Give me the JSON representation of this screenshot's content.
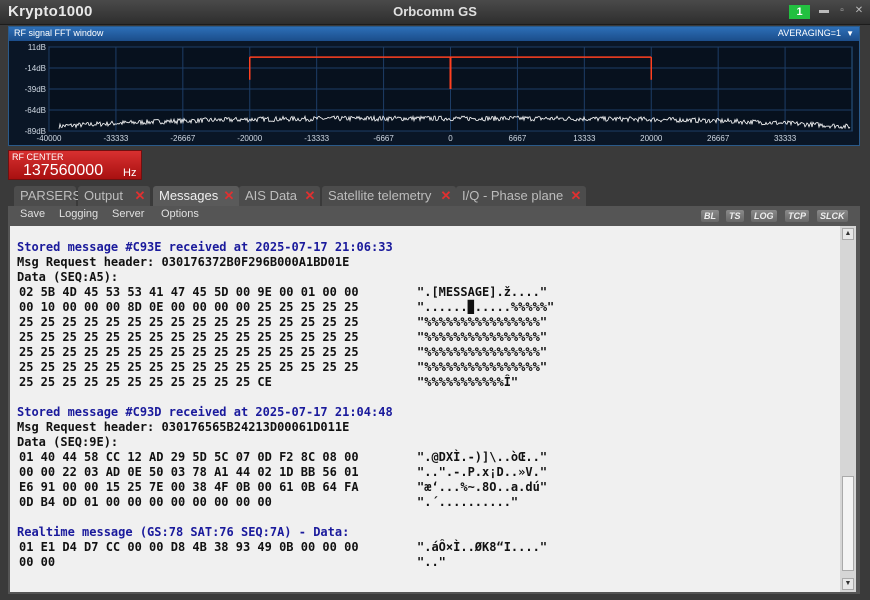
{
  "app": {
    "name": "Krypto1000",
    "title": "Orbcomm GS",
    "badge": "1"
  },
  "fft": {
    "title": "RF signal FFT window",
    "averaging": "AVERAGING=1",
    "y_labels": [
      "11dB",
      "-14dB",
      "-39dB",
      "-64dB",
      "-89dB"
    ],
    "x_labels": [
      "-40000",
      "-33333",
      "-26667",
      "-20000",
      "-13333",
      "-6667",
      "0",
      "6667",
      "13333",
      "20000",
      "26667",
      "33333"
    ],
    "x_range": [
      -40000,
      40000
    ],
    "y_range": [
      -89,
      11
    ],
    "markers_hz": [
      -20000,
      0,
      20000
    ],
    "colors": {
      "trace": "#ffffff",
      "marker": "#ff4020",
      "grid": "#1d3d66"
    }
  },
  "rf_center": {
    "label": "RF CENTER",
    "value": "137560000",
    "unit": "Hz"
  },
  "tabs": [
    {
      "label": "PARSERS",
      "closable": false,
      "active": false
    },
    {
      "label": "Output",
      "closable": true,
      "active": false
    },
    {
      "label": "Messages",
      "closable": true,
      "active": true
    },
    {
      "label": "AIS Data",
      "closable": true,
      "active": false
    },
    {
      "label": "Satellite telemetry",
      "closable": true,
      "active": false
    },
    {
      "label": "I/Q - Phase plane",
      "closable": true,
      "active": false
    }
  ],
  "toolbar": {
    "items": [
      "Save",
      "Logging",
      "Server",
      "Options"
    ],
    "flags": [
      "BL",
      "TS",
      "LOG",
      "TCP",
      "SLCK"
    ]
  },
  "messages": [
    {
      "header": "Stored message #C93E received at 2025-07-17 21:06:33",
      "req": "Msg Request header: 030176372B0F296B000A1BD01E",
      "data_label": "Data (SEQ:A5):",
      "rows": [
        {
          "hex": "02 5B 4D 45 53 53 41 47 45 5D 00 9E 00 01 00 00",
          "ascii": "\".[MESSAGE].ž....\""
        },
        {
          "hex": "00 10 00 00 00 8D 0E 00 00 00 00 25 25 25 25 25",
          "ascii": "\"......▉.....%%%%%\""
        },
        {
          "hex": "25 25 25 25 25 25 25 25 25 25 25 25 25 25 25 25",
          "ascii": "\"%%%%%%%%%%%%%%%%\""
        },
        {
          "hex": "25 25 25 25 25 25 25 25 25 25 25 25 25 25 25 25",
          "ascii": "\"%%%%%%%%%%%%%%%%\""
        },
        {
          "hex": "25 25 25 25 25 25 25 25 25 25 25 25 25 25 25 25",
          "ascii": "\"%%%%%%%%%%%%%%%%\""
        },
        {
          "hex": "25 25 25 25 25 25 25 25 25 25 25 25 25 25 25 25",
          "ascii": "\"%%%%%%%%%%%%%%%%\""
        },
        {
          "hex": "25 25 25 25 25 25 25 25 25 25 25 CE",
          "ascii": "\"%%%%%%%%%%%Î\""
        }
      ]
    },
    {
      "header": "Stored message #C93D received at 2025-07-17 21:04:48",
      "req": "Msg Request header: 030176565B24213D00061D011E",
      "data_label": "Data (SEQ:9E):",
      "rows": [
        {
          "hex": "01 40 44 58 CC 12 AD 29 5D 5C 07 0D F2 8C 08 00",
          "ascii": "\".@DXÌ.-)]\\..òŒ..\""
        },
        {
          "hex": "00 00 22 03 AD 0E 50 03 78 A1 44 02 1D BB 56 01",
          "ascii": "\"..\".-.P.x¡D..»V.\""
        },
        {
          "hex": "E6 91 00 00 15 25 7E 00 38 4F 0B 00 61 0B 64 FA",
          "ascii": "\"æ‘...%~.8O..a.dú\""
        },
        {
          "hex": "0D B4 0D 01 00 00 00 00 00 00 00 00",
          "ascii": "\".´..........\""
        }
      ]
    },
    {
      "header": "Realtime message (GS:78 SAT:76 SEQ:7A) - Data:",
      "rows": [
        {
          "hex": "01 E1 D4 D7 CC 00 00 D8 4B 38 93 49 0B 00 00 00",
          "ascii": "\".áÔ×Ì..ØK8“I....\""
        },
        {
          "hex": "00 00",
          "ascii": "\"..\""
        }
      ]
    }
  ]
}
